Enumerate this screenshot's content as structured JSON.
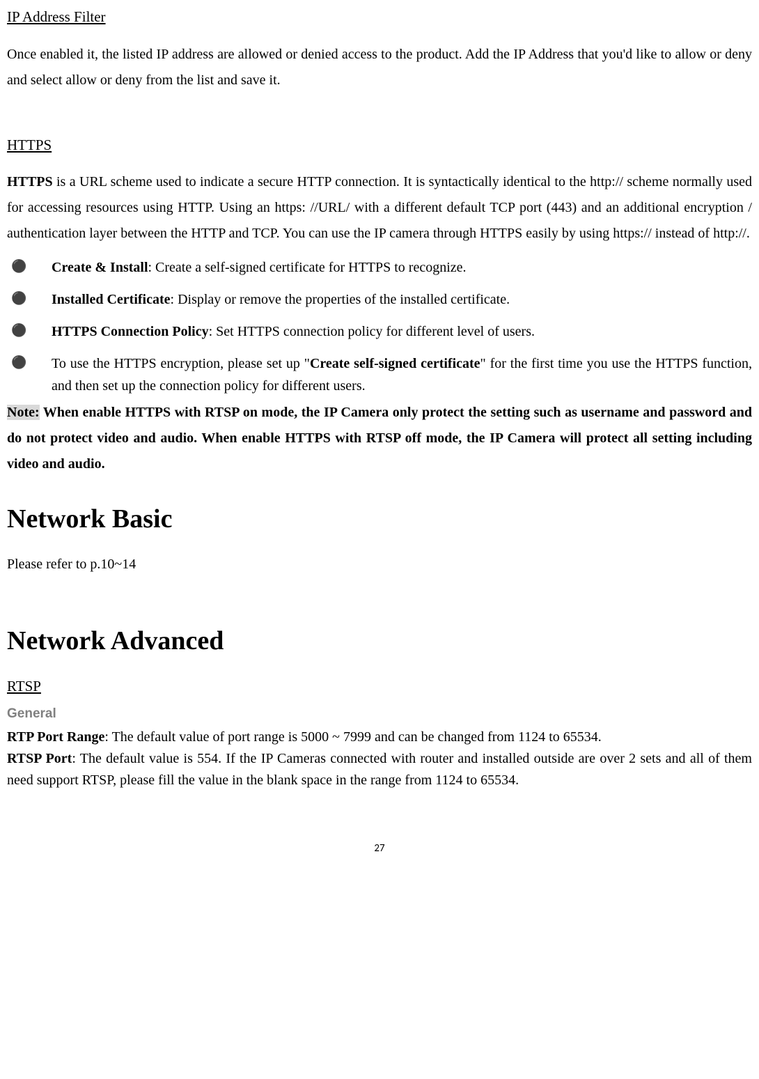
{
  "ipfilter": {
    "heading": "IP Address Filter",
    "para": "Once enabled it, the listed IP address are allowed or denied access to the product. Add the IP Address that you'd like to allow or deny and select allow or deny from the list and save it."
  },
  "https": {
    "heading": "HTTPS",
    "intro_prefix_bold": "HTTPS",
    "intro_rest": " is a URL scheme used to indicate a secure HTTP connection. It is syntactically identical to the http:// scheme normally used for accessing resources using HTTP. Using an https: //URL/ with a different default TCP port (443) and an additional encryption / authentication layer between the HTTP and TCP. You can use the IP camera through HTTPS easily by using https:// instead of http://.",
    "bullets": [
      {
        "label": "Create & Install",
        "text": ": Create a self-signed certificate for HTTPS to recognize."
      },
      {
        "label": "Installed Certificate",
        "text": ": Display or remove the properties of the installed certificate."
      },
      {
        "label": "HTTPS Connection Policy",
        "text": ": Set HTTPS connection policy for different level of users."
      }
    ],
    "bullet4_pre": "To use the HTTPS encryption, please set up \"",
    "bullet4_bold": "Create self-signed certificate",
    "bullet4_post": "\" for the first time you use the HTTPS function, and then set up the connection policy for different users.",
    "note_label": "Note:",
    "note_text": " When enable HTTPS with RTSP on mode, the IP Camera only protect the setting such as username and password and do not protect video and audio. When enable HTTPS with RTSP off mode, the IP Camera will protect all setting including video and audio."
  },
  "netbasic": {
    "heading": "Network Basic",
    "text": "Please refer to p.10~14"
  },
  "netadv": {
    "heading": "Network Advanced",
    "rtsp_heading": "RTSP",
    "general_label": "General",
    "rtp_label": "RTP Port Range",
    "rtp_text": ": The default value of port range is 5000 ~ 7999 and can be changed from 1124 to 65534.",
    "rtsp_label": "RTSP Port",
    "rtsp_text": ": The default value is 554. If the IP Cameras connected with router and installed outside are over 2 sets and all of them need support RTSP, please fill the value in the blank space in the range from 1124 to 65534."
  },
  "page_number": "27"
}
